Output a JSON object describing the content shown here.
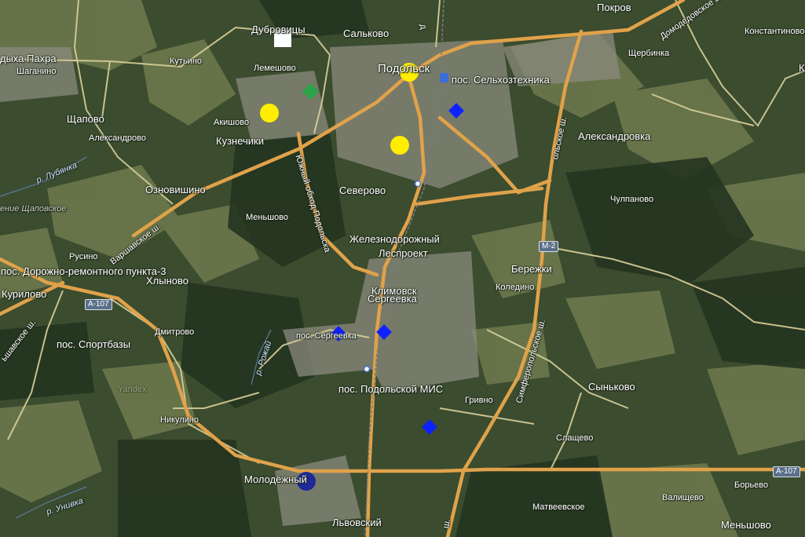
{
  "map": {
    "places": [
      "Дубровицы",
      "Сальково",
      "Покров",
      "Подольск",
      "пос. Сельхозтехника",
      "Щербинка",
      "Константиново",
      "Лемешово",
      "Кутьино",
      "Шаганино",
      "Щапово",
      "Акишово",
      "Кузнечики",
      "Александрово",
      "Александровка",
      "Озновишино",
      "Северово",
      "Чулпаново",
      "Меньшово",
      "Железнодорожный",
      "Леспроект",
      "Русино",
      "пос. Дорожно-ремонтного пункта-3",
      "Хлыново",
      "Климовск",
      "Сергеевка",
      "Бережки",
      "Коледино",
      "Курилово",
      "пос. Спортбазы",
      "Дмитрово",
      "пос. Сергеевка",
      "пос. Подольской МИС",
      "Гривно",
      "Сыньково",
      "Никулино",
      "Слащево",
      "Молодёжный",
      "Валищево",
      "Борьево",
      "Матвеевское",
      "Меньшово",
      "Львовский"
    ],
    "partial_places": [
      "дыха Пахра",
      "К"
    ],
    "water": [
      "р. Лубянка",
      "р. Рожай",
      "р. Унивка"
    ],
    "faded": [
      "ение Щаповское",
      "Yandex"
    ],
    "roads": [
      "Южный обход Подольска",
      "Варшавское ш.",
      "Симферопольское ш.",
      "Домодедовское ш.",
      "ьшавское ш.",
      "ольское ш.",
      "ш.",
      "д"
    ],
    "shields": [
      "М-2",
      "А-107",
      "А-107"
    ],
    "markers": [
      {
        "type": "square",
        "color": "#ffffff"
      },
      {
        "type": "diamond",
        "color": "#2aa34a"
      },
      {
        "type": "circle",
        "color": "#ffee00"
      },
      {
        "type": "circle",
        "color": "#ffee00"
      },
      {
        "type": "circle",
        "color": "#ffee00"
      },
      {
        "type": "diamond",
        "color": "#0d22ff"
      },
      {
        "type": "diamond",
        "color": "#0d22ff"
      },
      {
        "type": "diamond",
        "color": "#0d22ff"
      },
      {
        "type": "diamond",
        "color": "#0d22ff"
      },
      {
        "type": "circle",
        "color": "#1f2a99"
      }
    ]
  }
}
